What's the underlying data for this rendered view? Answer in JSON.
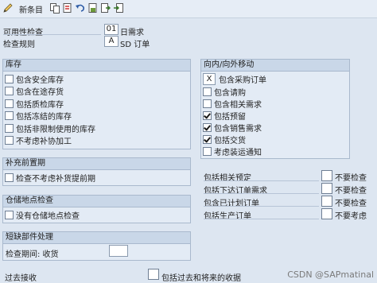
{
  "toolbar": {
    "new_entry_label": "新条目"
  },
  "fields": {
    "availability_check": {
      "label": "可用性检查",
      "code": "01",
      "desc": "日需求"
    },
    "check_rule": {
      "label": "检查规则",
      "code": "A",
      "desc": "SD 订单"
    }
  },
  "stock_group": {
    "title": "库存",
    "items": [
      {
        "label": "包含安全库存",
        "checked": false
      },
      {
        "label": "包含在途存货",
        "checked": false
      },
      {
        "label": "包括质检库存",
        "checked": false
      },
      {
        "label": "包括冻结的库存",
        "checked": false
      },
      {
        "label": "包括非限制使用的库存",
        "checked": false
      },
      {
        "label": "不考虑补协加工",
        "checked": false
      }
    ]
  },
  "replenish_group": {
    "title": "补充前置期",
    "items": [
      {
        "label": "检查不考虑补货提前期",
        "checked": false
      }
    ]
  },
  "storage_group": {
    "title": "仓储地点检查",
    "items": [
      {
        "label": "没有仓储地点检查",
        "checked": false
      }
    ]
  },
  "shortage_group": {
    "title": "短缺部件处理",
    "period_label": "检查期间: 收货",
    "period_value": ""
  },
  "movement_group": {
    "title": "向内/向外移动",
    "x_item": {
      "mark": "X",
      "label": "包含采购订单"
    },
    "items": [
      {
        "label": "包含请购",
        "checked": false
      },
      {
        "label": "包含相关需求",
        "checked": false
      },
      {
        "label": "包括预留",
        "checked": true
      },
      {
        "label": "包含销售需求",
        "checked": true
      },
      {
        "label": "包括交货",
        "checked": true
      },
      {
        "label": "考虑装运通知",
        "checked": false
      }
    ]
  },
  "consider_rows": [
    {
      "label": "包括相关预定",
      "value": "不要检查"
    },
    {
      "label": "包括下达订单需求",
      "value": "不要检查"
    },
    {
      "label": "包含已计划订单",
      "value": "不要检查"
    },
    {
      "label": "包括生产订单",
      "value": "不要考虑"
    }
  ],
  "bottom": {
    "past_receipts_label": "过去接收",
    "include_past_future_label": "包括过去和将来的收据"
  },
  "watermark": "CSDN @SAPmatinal"
}
